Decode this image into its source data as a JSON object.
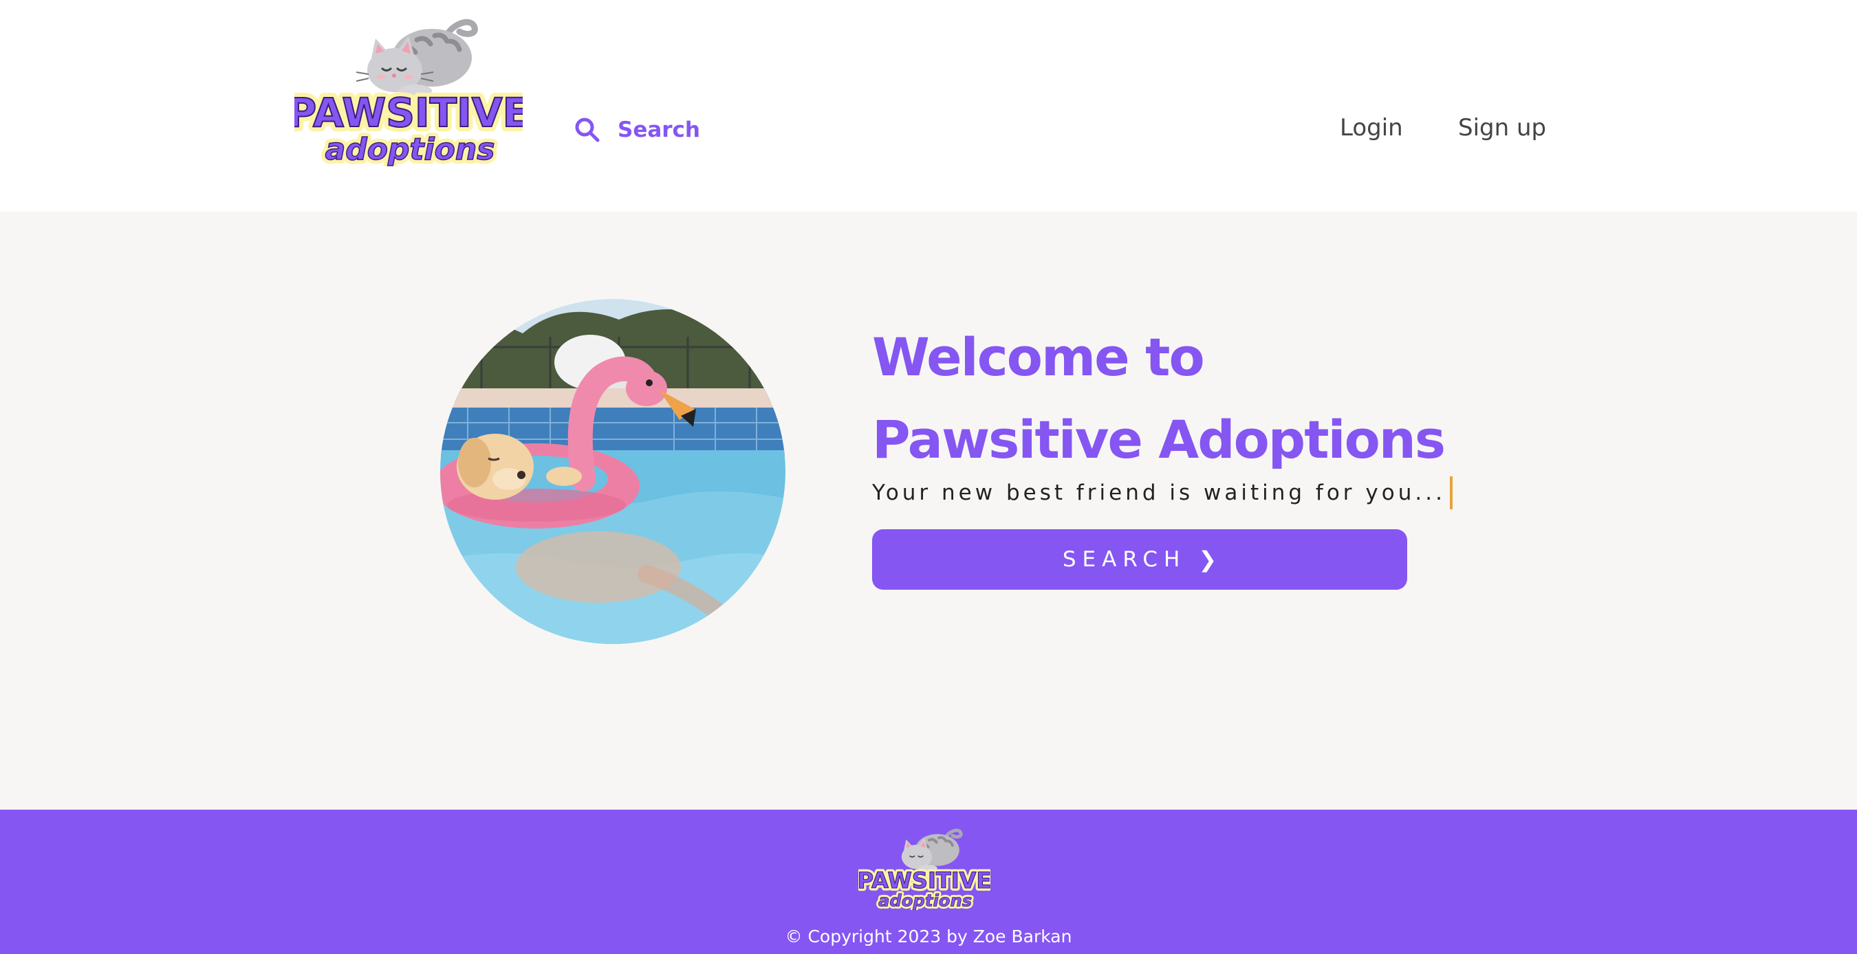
{
  "header": {
    "logo": {
      "line1": "PAWSITIVE",
      "line2": "adoptions"
    },
    "nav": {
      "search_label": "Search",
      "login_label": "Login",
      "signup_label": "Sign up"
    }
  },
  "hero": {
    "title_line1": "Welcome to",
    "title_line2": "Pawsitive Adoptions",
    "subtitle": "Your new best friend is waiting for you...",
    "button_label": "SEARCH",
    "button_chevron": "❯",
    "photo_subject": "golden retriever puppy floating in a pink flamingo pool ring"
  },
  "footer": {
    "logo": {
      "line1": "PAWSITIVE",
      "line2": "adoptions"
    },
    "copyright": "© Copyright 2023 by Zoe Barkan"
  },
  "colors": {
    "accent": "#8556f2",
    "hero_bg": "#f7f6f5",
    "logo_outline": "#fdf3a6",
    "nav_text": "#444444",
    "caret": "#e8a23a"
  },
  "icons": {
    "nav_search": "search-icon",
    "logo_mascot": "cat-icon",
    "button_chevron": "chevron-right-icon"
  }
}
